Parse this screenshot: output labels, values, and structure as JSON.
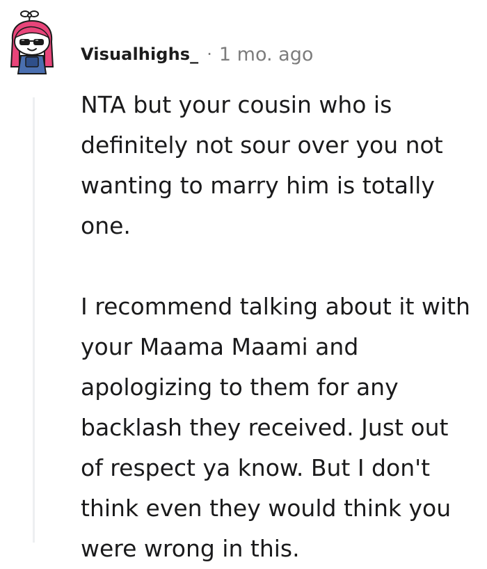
{
  "comment": {
    "username": "Visualhighs_",
    "separator": "·",
    "time": "1 mo. ago",
    "paragraphs": [
      "NTA but your cousin who is definitely not sour over you not wanting to marry him is totally one.",
      "I recommend talking about it with your Maama Maami and apologizing to them for any backlash they received. Just out of respect ya know. But I don't think even they would think you were wrong in this."
    ],
    "avatar": {
      "icon": "snoo-avatar-icon",
      "hair_color": "#e8457a",
      "outfit_color": "#4a6fb0"
    }
  }
}
